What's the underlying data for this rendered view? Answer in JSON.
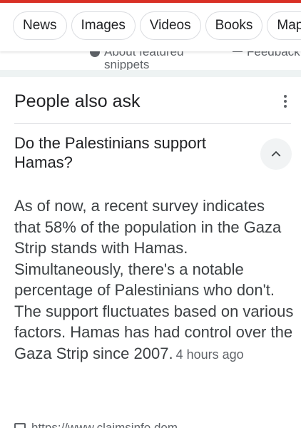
{
  "filter_tabs": [
    "News",
    "Images",
    "Videos",
    "Books",
    "Maps"
  ],
  "snippet_footer": {
    "about_label": "About featured snippets",
    "feedback_label": "Feedback"
  },
  "people_also_ask": {
    "heading": "People also ask",
    "question": "Do the Palestinians support Hamas?",
    "answer": "As of now, a recent survey indicates that 58% of the population in the Gaza Strip stands with Hamas. Simultaneously, there's a notable percentage of Palestinians who don't. The support fluctuates based on various factors. Hamas has had control over the Gaza Strip since 2007.",
    "timestamp": "4 hours ago",
    "source_link_partial": "https://www.claimsinfo.dom..."
  },
  "icons": {
    "more": "more-vert-icon",
    "collapse": "chevron-up-icon",
    "about": "info-icon",
    "feedback": "feedback-icon",
    "source": "link-icon"
  },
  "colors": {
    "accent": "#d93025",
    "band": "#eef3f3",
    "chip_border": "#dadce0",
    "toggle_bg": "#f1f3f4"
  }
}
